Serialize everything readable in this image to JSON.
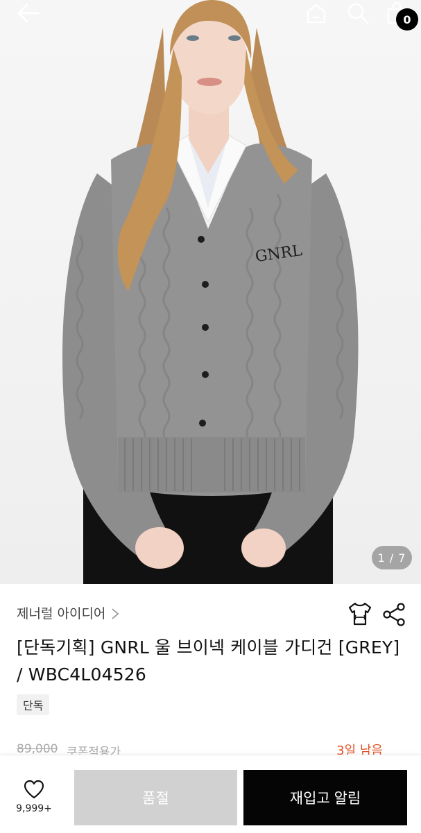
{
  "header": {
    "cart_count": "0",
    "icons": [
      "back-arrow-icon",
      "home-icon",
      "search-icon",
      "cart-icon"
    ]
  },
  "gallery": {
    "counter": "1 / 7"
  },
  "product": {
    "brand": "제너럴 아이디어",
    "title": "[단독기획] GNRL 울 브이넥 케이블 가디건 [GREY] / WBC4L04526",
    "badge": "단독",
    "original_price": "89,000",
    "coupon_text": "쿠폰적용가",
    "days_left": "3일 남음"
  },
  "actions": {
    "wish_count": "9,999+",
    "soldout_label": "품절",
    "restock_label": "재입고 알림"
  },
  "colors": {
    "accent": "#e0542a",
    "primary_button": "#050505",
    "disabled_button": "#d1d1d1",
    "sweater": "#8e8e8e"
  }
}
